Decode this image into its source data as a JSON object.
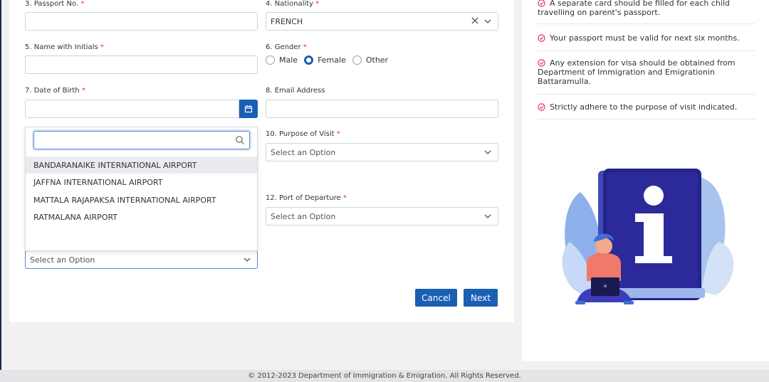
{
  "form": {
    "passport_label": "3. Passport No.",
    "passport_value": "",
    "nationality_label": "4. Nationality",
    "nationality_value": "FRENCH",
    "name_label": "5. Name with Initials",
    "name_value": "",
    "gender_label": "6. Gender",
    "gender_options": [
      "Male",
      "Female",
      "Other"
    ],
    "gender_selected": "Female",
    "dob_label": "7. Date of Birth",
    "dob_value": "",
    "email_label": "8. Email Address",
    "email_value": "",
    "purpose_label": "10. Purpose of Visit",
    "purpose_placeholder": "Select an Option",
    "departure_label": "12. Port of Departure",
    "departure_placeholder": "Select an Option",
    "port_placeholder": "Select an Option",
    "required_mark": "*"
  },
  "port_dropdown": {
    "search_value": "",
    "options": [
      "BANDARANAIKE INTERNATIONAL AIRPORT",
      "JAFFNA INTERNATIONAL AIRPORT",
      "MATTALA RAJAPAKSA INTERNATIONAL AIRPORT",
      "RATMALANA AIRPORT"
    ],
    "highlighted_index": 0
  },
  "buttons": {
    "cancel": "Cancel",
    "next": "Next"
  },
  "info": {
    "items": [
      "A separate card should be filled for each child travelling on parent's passport.",
      "Your passport must be valid for next six months.",
      "Any extension for visa should be obtained from Department of Immigration and Emigrationin Battaramulla.",
      "Strictly adhere to the purpose of visit indicated."
    ]
  },
  "footer": {
    "text": "© 2012-2023 Department of Immigration & Emigration. All Rights Reserved."
  },
  "colors": {
    "primary": "#1a5fb4",
    "required": "#e23232",
    "check": "#e0336f"
  }
}
